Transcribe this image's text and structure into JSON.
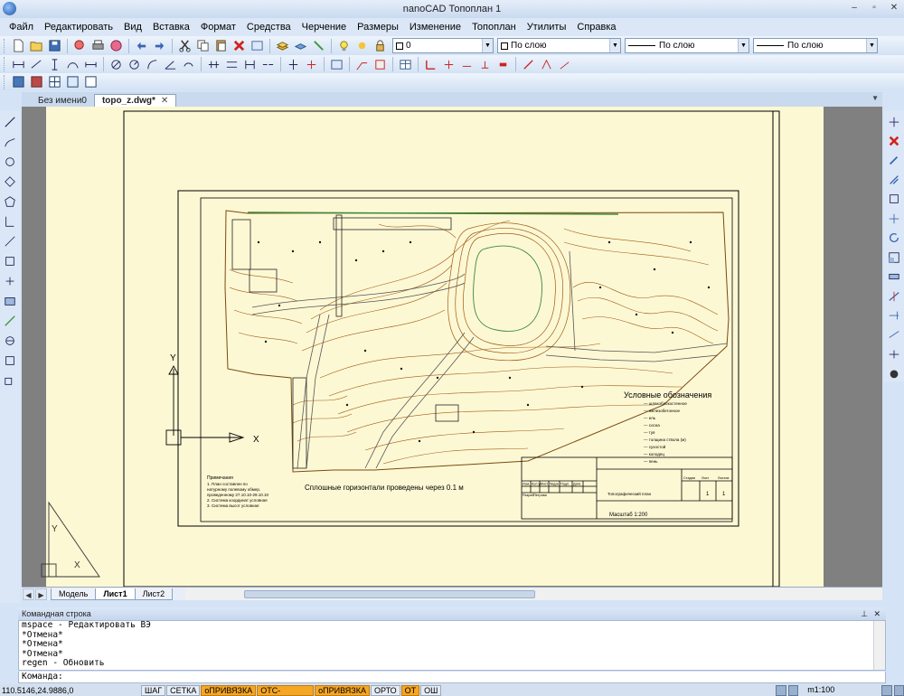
{
  "window": {
    "title": "nanoCAD Топоплан 1",
    "minimize": "–",
    "restore": "▫",
    "close": "✕"
  },
  "menu": [
    "Файл",
    "Редактировать",
    "Вид",
    "Вставка",
    "Формат",
    "Средства",
    "Черчение",
    "Размеры",
    "Изменение",
    "Топоплан",
    "Утилиты",
    "Справка"
  ],
  "properties": {
    "layer": "0",
    "color": "По слою",
    "linetype": "По слою",
    "lineweight": "По слою"
  },
  "doc_tabs": [
    {
      "label": "Без имени0",
      "active": false
    },
    {
      "label": "topo_z.dwg*",
      "active": true,
      "close": "✕"
    }
  ],
  "drawing": {
    "legend_title": "Условные обозначения",
    "legend_items": [
      "— шлакоблокостенное",
      "— железобетонное",
      "— ель",
      "— сосна",
      "— туя",
      "— толщина ствола (м)",
      "— сухостой",
      "— колодец",
      "— пень"
    ],
    "contour_note": "Сплошные горизонтали проведены через 0.1 м",
    "notes_title": "Примечания",
    "notes": [
      "1. План составлен по",
      "натурному полевому обмер.",
      "проведенному 27.10.10-29.10.10",
      "2. Система координат условная",
      "3. Система высот условная"
    ],
    "stamp_title": "Топографический план",
    "stamp_scale": "Масштаб 1:200",
    "stamp_sheet_header": [
      "Стадия",
      "Лист",
      "Листов"
    ],
    "stamp_sheet_values": [
      "",
      "1",
      "1"
    ],
    "stamp_row_labels": [
      "Изм.",
      "Кол.уч",
      "Лист",
      "№док",
      "Подп.",
      "Дата"
    ],
    "stamp_developer": [
      "Разраб.",
      "Петрова"
    ]
  },
  "ucs": {
    "y": "Y",
    "x": "X"
  },
  "layout_tabs": [
    {
      "label": "Модель",
      "active": false
    },
    {
      "label": "Лист1",
      "active": true
    },
    {
      "label": "Лист2",
      "active": false
    }
  ],
  "command": {
    "header": "Командная строка",
    "history": [
      "mspace - Редактировать ВЭ",
      "*Отмена*",
      "*Отмена*",
      "*Отмена*",
      "regen - Обновить"
    ],
    "prompt": "Команда:"
  },
  "status": {
    "coords": "110.5146,24.9886,0",
    "toggles": [
      {
        "label": "ШАГ",
        "on": false
      },
      {
        "label": "СЕТКА",
        "on": false
      },
      {
        "label": "оПРИВЯЗКА",
        "on": true
      },
      {
        "label": "ОТС-ОБЪЕКТ",
        "on": true
      },
      {
        "label": "оПРИВЯЗКА",
        "on": true
      },
      {
        "label": "ОРТО",
        "on": false
      },
      {
        "label": "ОТ",
        "on": true
      },
      {
        "label": "ОШ",
        "on": false
      }
    ],
    "scale": "m1:100"
  },
  "colors": {
    "paper": "#fdf8d4",
    "contour": "#a05a14",
    "border": "#000000",
    "status_on": "#f5a623"
  }
}
